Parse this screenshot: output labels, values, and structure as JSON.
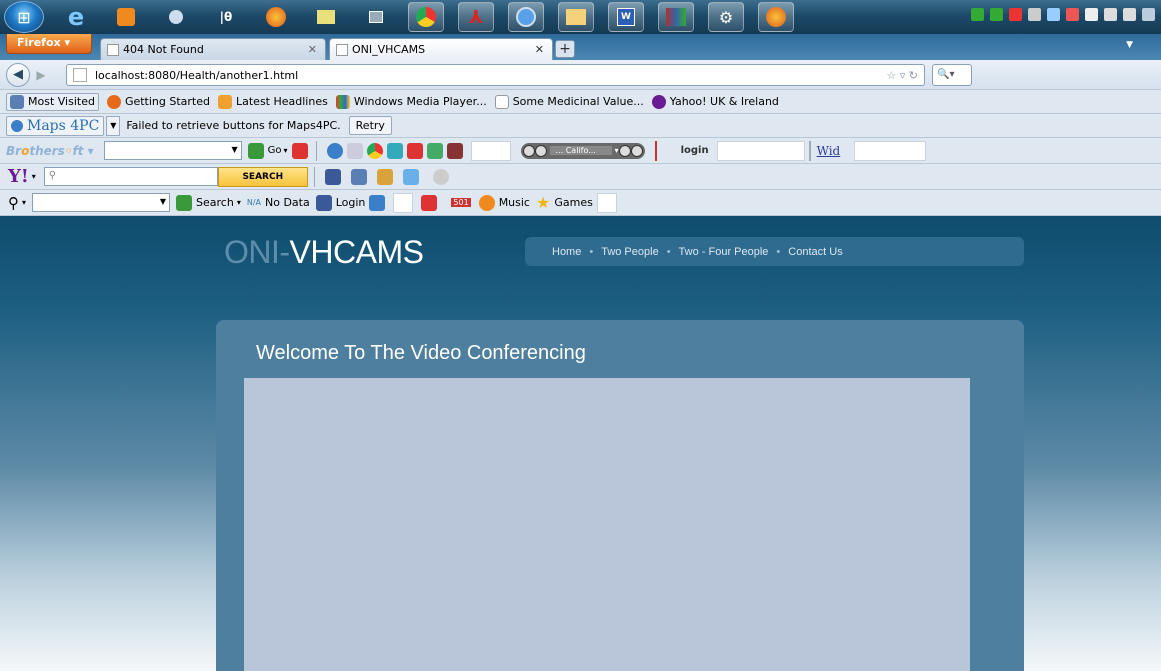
{
  "taskbar": {
    "icons": [
      "ie-icon",
      "media-player-icon",
      "webcam-icon",
      "app-icon",
      "firefox-icon",
      "sticky-notes-icon",
      "computer-icon",
      "chrome-icon",
      "pdf-icon",
      "itunes-icon",
      "explorer-icon",
      "word-icon",
      "winrar-icon",
      "settings-icon",
      "firefox-active-icon"
    ]
  },
  "browser": {
    "menu_button": "Firefox",
    "tabs": [
      {
        "label": "404 Not Found",
        "active": false
      },
      {
        "label": "ONI_VHCAMS",
        "active": true
      }
    ],
    "url": "localhost:8080/Health/another1.html"
  },
  "bookmarks": [
    {
      "label": "Most Visited",
      "color": "#5a7fb4"
    },
    {
      "label": "Getting Started",
      "color": "#e66a1a"
    },
    {
      "label": "Latest Headlines",
      "color": "#f0a030"
    },
    {
      "label": "Windows Media Player...",
      "color": "#3a8ad8"
    },
    {
      "label": "Some Medicinal Value...",
      "color": "#ffffff"
    },
    {
      "label": "Yahoo! UK & Ireland",
      "color": "#6a1a94"
    }
  ],
  "maps4pc": {
    "brand": "Maps 4PC",
    "message": "Failed to retrieve buttons for Maps4PC.",
    "retry_label": "Retry"
  },
  "brothersoft": {
    "logo_prefix": "Br",
    "logo_o": "o",
    "logo_suffix": "thers",
    "logo_end": "ft",
    "go_label": "Go",
    "radio_station": "... Califo...",
    "login_label": "login",
    "wid_label": "Wid"
  },
  "yahoo": {
    "logo": "Y!",
    "search_label": "SEARCH"
  },
  "toolbar3": {
    "search_label": "Search",
    "nodata_prefix": "N/A",
    "nodata_label": "No Data",
    "login_label": "Login",
    "badge": "501",
    "music_label": "Music",
    "games_label": "Games"
  },
  "page": {
    "logo_part1": "ONI-",
    "logo_part2": "VHCAMS",
    "nav": [
      "Home",
      "Two People",
      "Two - Four People",
      "Contact Us"
    ],
    "panel_title": "Welcome To The Video Conferencing"
  }
}
